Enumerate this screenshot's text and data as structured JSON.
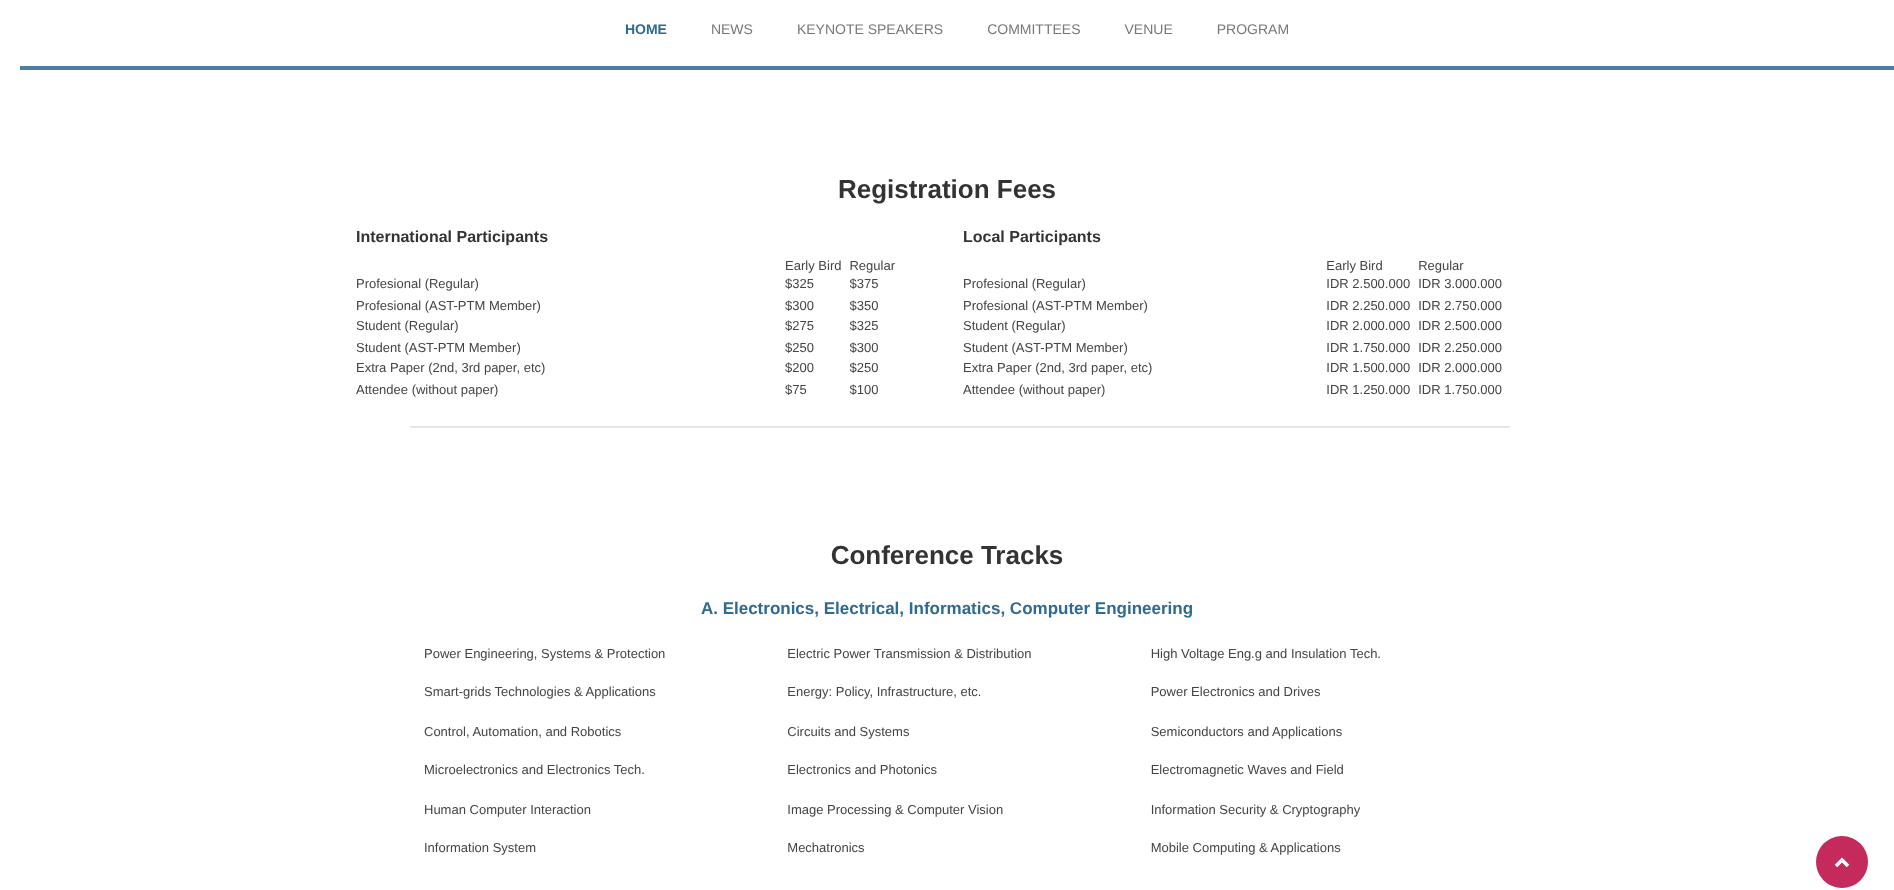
{
  "nav": [
    {
      "label": "HOME",
      "selected": true
    },
    {
      "label": "NEWS",
      "selected": false
    },
    {
      "label": "KEYNOTE SPEAKERS",
      "selected": false
    },
    {
      "label": "COMMITTEES",
      "selected": false
    },
    {
      "label": "VENUE",
      "selected": false
    },
    {
      "label": "PROGRAM",
      "selected": false
    }
  ],
  "registration": {
    "title": "Registration Fees",
    "tables": [
      {
        "title": "International Participants",
        "columns": [
          "",
          "Early Bird",
          "Regular"
        ],
        "rows": [
          [
            "Profesional (Regular)",
            "$325",
            "$375"
          ],
          [
            "Profesional (AST-PTM Member)",
            "$300",
            "$350"
          ],
          [
            "Student (Regular)",
            "$275",
            "$325"
          ],
          [
            "Student (AST-PTM Member)",
            "$250",
            "$300"
          ],
          [
            "Extra Paper (2nd, 3rd paper, etc)",
            "$200",
            "$250"
          ],
          [
            "Attendee (without paper)",
            "$75",
            "$100"
          ]
        ]
      },
      {
        "title": "Local Participants",
        "columns": [
          "",
          "Early Bird",
          "Regular"
        ],
        "rows": [
          [
            "Profesional (Regular)",
            "IDR 2.500.000",
            "IDR 3.000.000"
          ],
          [
            "Profesional (AST-PTM Member)",
            "IDR 2.250.000",
            "IDR 2.750.000"
          ],
          [
            "Student (Regular)",
            "IDR 2.000.000",
            "IDR 2.500.000"
          ],
          [
            "Student (AST-PTM Member)",
            "IDR 1.750.000",
            "IDR 2.250.000"
          ],
          [
            "Extra Paper (2nd, 3rd paper, etc)",
            "IDR 1.500.000",
            "IDR 2.000.000"
          ],
          [
            "Attendee (without paper)",
            "IDR 1.250.000",
            "IDR 1.750.000"
          ]
        ]
      }
    ]
  },
  "tracks": {
    "title": "Conference Tracks",
    "subtitle": "A. Electronics, Electrical, Informatics, Computer Engineering",
    "items": [
      "Power Engineering, Systems & Protection",
      "Electric Power Transmission & Distribution",
      "High Voltage Eng.g and Insulation Tech.",
      "Smart-grids Technologies & Applications",
      "Energy: Policy, Infrastructure, etc.",
      "Power Electronics and Drives",
      "Control, Automation, and Robotics",
      "Circuits and Systems",
      "Semiconductors and Applications",
      "Microelectronics and Electronics Tech.",
      "Electronics and Photonics",
      "Electromagnetic Waves and Field",
      "Human Computer Interaction",
      "Image Processing & Computer Vision",
      "Information Security & Cryptography",
      "Information System",
      "Mechatronics",
      "Mobile Computing & Applications"
    ]
  }
}
